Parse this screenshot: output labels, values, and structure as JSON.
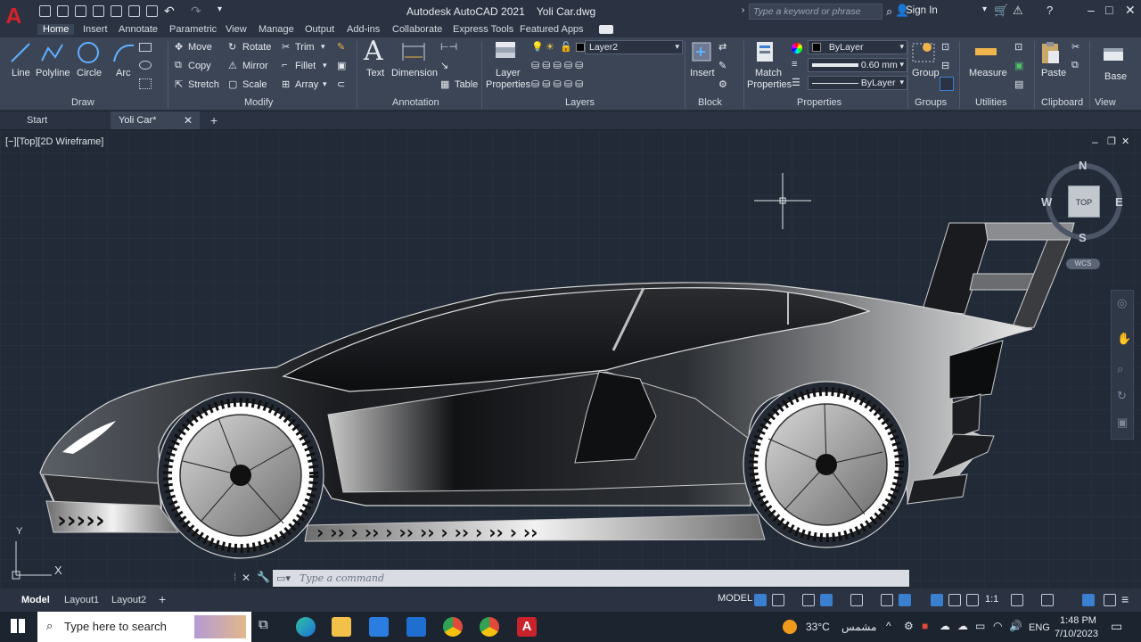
{
  "app": {
    "logo_letter": "A",
    "title": "Autodesk AutoCAD 2021",
    "filename": "Yoli Car.dwg",
    "search_placeholder": "Type a keyword or phrase",
    "sign_in": "Sign In"
  },
  "ribbon_tabs": [
    "Home",
    "Insert",
    "Annotate",
    "Parametric",
    "View",
    "Manage",
    "Output",
    "Add-ins",
    "Collaborate",
    "Express Tools",
    "Featured Apps"
  ],
  "ribbon": {
    "draw": {
      "title": "Draw",
      "line": "Line",
      "polyline": "Polyline",
      "circle": "Circle",
      "arc": "Arc"
    },
    "modify": {
      "title": "Modify",
      "move": "Move",
      "rotate": "Rotate",
      "trim": "Trim",
      "copy": "Copy",
      "mirror": "Mirror",
      "fillet": "Fillet",
      "stretch": "Stretch",
      "scale": "Scale",
      "array": "Array"
    },
    "annotation": {
      "title": "Annotation",
      "text": "Text",
      "dimension": "Dimension",
      "table": "Table"
    },
    "layers": {
      "title": "Layers",
      "layer_properties_1": "Layer",
      "layer_properties_2": "Properties",
      "current_layer": "Layer2"
    },
    "block": {
      "title": "Block",
      "insert": "Insert"
    },
    "properties": {
      "title": "Properties",
      "match_1": "Match",
      "match_2": "Properties",
      "color": "ByLayer",
      "lineweight": "0.60 mm",
      "linetype": "ByLayer"
    },
    "groups": {
      "title": "Groups",
      "group": "Group"
    },
    "utilities": {
      "title": "Utilities",
      "measure": "Measure"
    },
    "clipboard": {
      "title": "Clipboard",
      "paste": "Paste"
    },
    "view": {
      "title": "View",
      "base": "Base"
    }
  },
  "file_tabs": {
    "start": "Start",
    "active": "Yoli Car*"
  },
  "viewport": {
    "label": "[−][Top][2D Wireframe]",
    "viewcube": {
      "n": "N",
      "s": "S",
      "e": "E",
      "w": "W",
      "face": "TOP",
      "wcs": "WCS"
    },
    "ucs": {
      "y": "Y",
      "x": "X"
    }
  },
  "command_line": {
    "placeholder": "Type a command"
  },
  "layout_tabs": {
    "model": "Model",
    "layout1": "Layout1",
    "layout2": "Layout2"
  },
  "status_bar": {
    "model": "MODEL",
    "scale": "1:1"
  },
  "taskbar": {
    "search": "Type here to search",
    "weather": "33°C",
    "weather_text": "مشمس",
    "lang": "ENG",
    "time": "1:48 PM",
    "date": "7/10/2023"
  },
  "colors": {
    "accent": "#3a7fd0",
    "brand": "#d1232a",
    "canvas": "#212a36",
    "ribbon": "#3b4556"
  }
}
